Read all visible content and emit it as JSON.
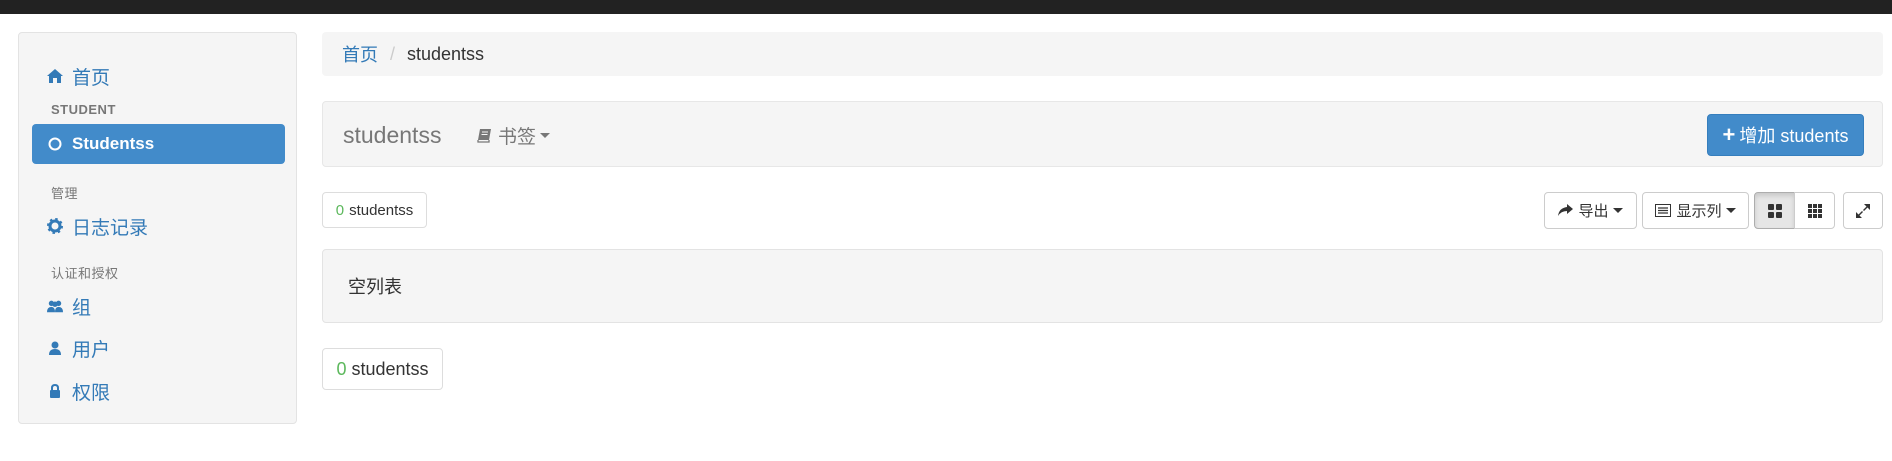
{
  "sidebar": {
    "items": [
      {
        "label": "首页",
        "icon": "home-icon"
      },
      {
        "label": "Studentss",
        "icon": "circle-icon",
        "active": true
      },
      {
        "label": "日志记录",
        "icon": "gear-icon"
      },
      {
        "label": "组",
        "icon": "users-icon"
      },
      {
        "label": "用户",
        "icon": "user-icon"
      },
      {
        "label": "权限",
        "icon": "lock-icon"
      }
    ],
    "headers": [
      "STUDENT",
      "管理",
      "认证和授权"
    ]
  },
  "breadcrumb": {
    "home": "首页",
    "separator": "/",
    "current": "studentss"
  },
  "header": {
    "title": "studentss",
    "bookmark_label": "书签",
    "add_button_label": "增加 students"
  },
  "counts": {
    "top_num": "0",
    "top_label": "studentss",
    "bottom_num": "0",
    "bottom_label": "studentss"
  },
  "toolbar": {
    "export_label": "导出",
    "columns_label": "显示列"
  },
  "list": {
    "empty_text": "空列表"
  },
  "colors": {
    "accent": "#428bca",
    "link": "#337ab7",
    "count_num": "#5cb85c",
    "topbar": "#222222"
  }
}
